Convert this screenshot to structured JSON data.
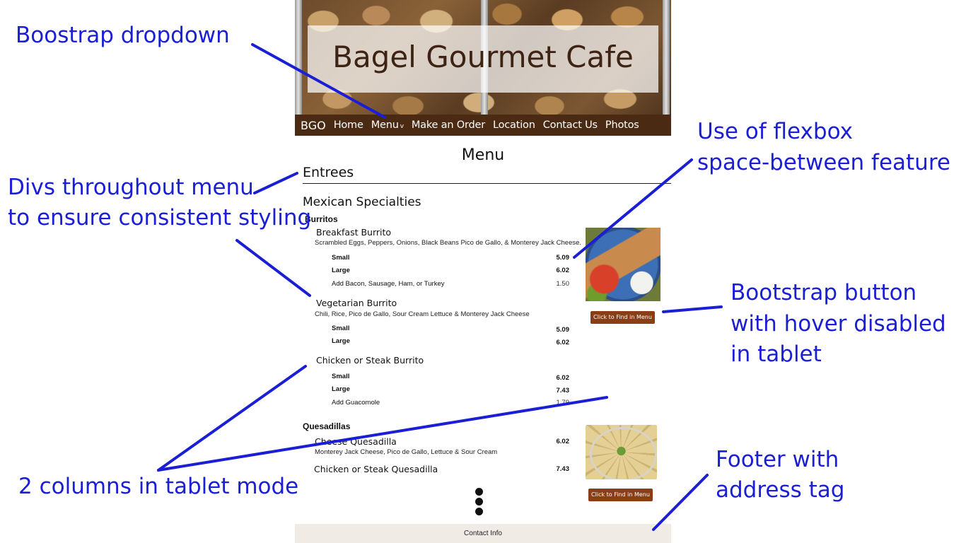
{
  "site": {
    "hero_title": "Bagel Gourmet Cafe",
    "nav": {
      "brand": "BGO",
      "items": [
        "Home",
        "Menu",
        "Make an Order",
        "Location",
        "Contact Us",
        "Photos"
      ],
      "dropdown_caret": "v"
    },
    "page_heading": "Menu",
    "entrees_heading": "Entrees",
    "section_title": "Mexican Specialties",
    "burritos": {
      "category": "Burritos",
      "items": [
        {
          "name": "Breakfast Burrito",
          "description": "Scrambled Eggs, Peppers, Onions, Black Beans Pico de Gallo, & Monterey Jack Cheese.",
          "options": [
            {
              "label": "Small",
              "price": "5.09"
            },
            {
              "label": "Large",
              "price": "6.02"
            },
            {
              "label": "Add Bacon, Sausage, Ham, or Turkey",
              "price": "1.50"
            }
          ]
        },
        {
          "name": "Vegetarian Burrito",
          "description": "Chili, Rice, Pico de Gallo, Sour Cream Lettuce & Monterey Jack Cheese",
          "options": [
            {
              "label": "Small",
              "price": "5.09"
            },
            {
              "label": "Large",
              "price": "6.02"
            }
          ]
        },
        {
          "name": "Chicken or Steak Burrito",
          "options": [
            {
              "label": "Small",
              "price": "6.02"
            },
            {
              "label": "Large",
              "price": "7.43"
            },
            {
              "label": "Add Guacomole",
              "price": "1.79"
            }
          ]
        }
      ],
      "button_label": "Click to Find in Menu"
    },
    "quesadillas": {
      "category": "Quesadillas",
      "items": [
        {
          "name": "Cheese Quesadilla",
          "description": "Monterey Jack Cheese, Pico de Gallo,  Lettuce & Sour Cream",
          "price": "6.02"
        },
        {
          "name": "Chicken or Steak Quesadilla",
          "price": "7.43"
        }
      ],
      "button_label": "Click to Find in Menu"
    },
    "footer": "Contact Info"
  },
  "annotations": {
    "dropdown": "Boostrap dropdown",
    "flexbox_line1": "Use of flexbox",
    "flexbox_line2": "space-between feature",
    "divs_line1": "Divs throughout menu",
    "divs_line2": "to ensure consistent styling",
    "button_line1": "Bootstrap button",
    "button_line2": "with hover disabled",
    "button_line3": "in tablet",
    "columns": "2 columns in tablet mode",
    "footer_line1": "Footer with",
    "footer_line2": "address tag"
  },
  "colors": {
    "annotation": "#1a1fd6",
    "navbar": "#4a2a12",
    "button": "#8a3e16",
    "footer_bg": "#f1ebe6"
  }
}
